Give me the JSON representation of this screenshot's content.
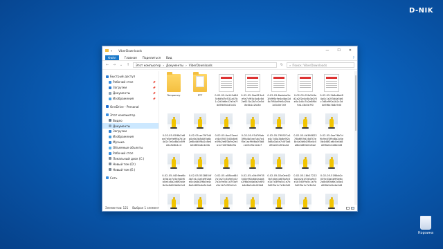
{
  "brand": "D-NIK",
  "desktop": {
    "recycle_label": "Корзина"
  },
  "window": {
    "title": "ViberDownloads",
    "controls": {
      "minimize": "—",
      "maximize": "☐",
      "close": "✕"
    },
    "ribbon": {
      "file": "Файл",
      "tabs": [
        "Главная",
        "Поделиться",
        "Вид"
      ],
      "help": "?"
    },
    "address": {
      "segments": [
        "Этот компьютер",
        "Документы",
        "ViberDownloads"
      ],
      "search_placeholder": "Поиск: ViberDownloads"
    },
    "nav": [
      {
        "label": "Быстрый доступ",
        "icon": "star-icon",
        "color": "#2f7fd3",
        "pin": false,
        "sub": false
      },
      {
        "label": "Рабочий стол",
        "icon": "desktop-icon",
        "color": "#3b8fe0",
        "pin": true,
        "sub": true
      },
      {
        "label": "Загрузки",
        "icon": "download-icon",
        "color": "#2f7fd3",
        "pin": true,
        "sub": true
      },
      {
        "label": "Документы",
        "icon": "documents-icon",
        "color": "#8aa2b8",
        "pin": true,
        "sub": true
      },
      {
        "label": "Изображения",
        "icon": "pictures-icon",
        "color": "#4aa0e0",
        "pin": true,
        "sub": true
      },
      {
        "label": "OneDrive - Personal",
        "icon": "cloud-icon",
        "color": "#1f6fd0",
        "pin": false,
        "sub": false,
        "gap": true
      },
      {
        "label": "Этот компьютер",
        "icon": "computer-icon",
        "color": "#3b8fe0",
        "pin": false,
        "sub": false,
        "gap": true
      },
      {
        "label": "Видео",
        "icon": "video-icon",
        "color": "#6a7b8c",
        "pin": false,
        "sub": true
      },
      {
        "label": "Документы",
        "icon": "documents-icon",
        "color": "#8aa2b8",
        "pin": false,
        "sub": true,
        "selected": true
      },
      {
        "label": "Загрузки",
        "icon": "download-icon",
        "color": "#2f7fd3",
        "pin": false,
        "sub": true
      },
      {
        "label": "Изображения",
        "icon": "pictures-icon",
        "color": "#4aa0e0",
        "pin": false,
        "sub": true
      },
      {
        "label": "Музыка",
        "icon": "music-icon",
        "color": "#2f7fd3",
        "pin": false,
        "sub": true
      },
      {
        "label": "Объемные объекты",
        "icon": "3d-objects-icon",
        "color": "#5ab0e8",
        "pin": false,
        "sub": true
      },
      {
        "label": "Рабочий стол",
        "icon": "desktop-icon",
        "color": "#3b8fe0",
        "pin": false,
        "sub": true
      },
      {
        "label": "Локальный диск (C:)",
        "icon": "drive-icon",
        "color": "#7f8c99",
        "pin": false,
        "sub": true
      },
      {
        "label": "Новый том (D:)",
        "icon": "drive-icon",
        "color": "#7f8c99",
        "pin": false,
        "sub": true
      },
      {
        "label": "Новый том (E:)",
        "icon": "drive-icon",
        "color": "#7f8c99",
        "pin": false,
        "sub": true
      },
      {
        "label": "Сеть",
        "icon": "network-icon",
        "color": "#3b8fe0",
        "pin": false,
        "sub": false,
        "gap": true
      }
    ],
    "files": [
      {
        "name": "Temporary",
        "kind": "folder"
      },
      {
        "name": "PTT",
        "kind": "folder-doc"
      },
      {
        "name": "0-02-05-0a141d865c6dfd7e531a47b1c2d0d6e47a0e7fdd5fb9b1d3c01",
        "kind": "doc"
      },
      {
        "name": "0-02-05-1ba813e4e9a7c9f4c0a4c6d2e61f1a2b7c0e5d8e0b1c2fa3e",
        "kind": "doc"
      },
      {
        "name": "0-02-05-8adebe2e1fd9f6c9e4e4be2d8c7f64a9fe5a2fcb1d3c0e7a9",
        "kind": "doc"
      },
      {
        "name": "0-02-05-05fe5b3ad2a2f2e4c6b3e2f0e0a1d4c7b2e8f6d9a1c3b5e7f0",
        "kind": "doc"
      },
      {
        "name": "0-02-05-2b8a6bd84a0c1e2f3d4a5b6c7d8e9f0a1b2c3d4e5f6a7b8c9d0",
        "kind": "doc"
      },
      {
        "name": "",
        "kind": "empty"
      },
      {
        "name": "0-02-05-05f8b2d6ee7e5e9eff6a7d1e4d2c7e0a8b3c6f9d2a5e8b1c4",
        "kind": "photo"
      },
      {
        "name": "0-02-05-ae79f7d4a0c6e2b8d4f0a6c2e8b4d0f6a2c8e4b0d6f2a8c4e0b",
        "kind": "photo"
      },
      {
        "name": "0-02-05-6ac52eedcf4c09057d3b6e6e59b2e6f3b9e2e4a1c7d0f3b6e9a",
        "kind": "photo"
      },
      {
        "name": "0-02-05-97d7f6ab3f9b4b5ee7ab7e4f5e1ac9fd6a0f3b8c2e5d9a1b4c7",
        "kind": "photo"
      },
      {
        "name": "0-02-05-7ff0927a1e4c7d0a3b6e9f2c5d8a1b4e7c0f3a6d9b2e5c8f1a4d",
        "kind": "photo"
      },
      {
        "name": "0-02-05-4b36082276b6f09d16d7f2e8c4a0b6d2f8e4c0a6b2d8f4e0c6a2",
        "kind": "photo"
      },
      {
        "name": "0-02-05-0ae76b7d9b9e4f3f9d8a2c6e0b4d8f2a6c0e4b8d2f6a0c4e8b2d6",
        "kind": "photo"
      },
      {
        "name": "",
        "kind": "empty"
      },
      {
        "name": "0-02-05-4436ea6b4f3b1e7c5a9d2f6b0e4c8a2d6f0b4e8c2a6d0f4b8e2c6",
        "kind": "photo"
      },
      {
        "name": "0-02-05-5528654f4b7e1c3a5d9f2b6e0c4a8d2f6b0e4c8a2d6f0b4e8c2a6",
        "kind": "photo"
      },
      {
        "name": "0-02-05-a08bcd847a7a27c3b9e5d1f7a3c9e5b1d7f3a9c5e1b7d3f9a5c1",
        "kind": "photo"
      },
      {
        "name": "0-02-05-c0d49978540e9f2b6d0a4e8c2f6b0d4a8e2c6f0b4d8a2e6c0f4b8",
        "kind": "photo"
      },
      {
        "name": "0-02-05-02a0ed427b7d0e1b6f3a9c5e1b7d3f9a5c1e7b3d9f5a1c7e3b9d5",
        "kind": "photo"
      },
      {
        "name": "0-02-05-18b172220a3e2b1f7d3a9c5e1b7d3f9a5c1e7b3d9f5a1c7e3b9d",
        "kind": "photo"
      },
      {
        "name": "0-02-05-51f8bb2c039c03a4b9f0e6c2a8d4f0b6e2c8a4d0f6b2e8c4a0d6",
        "kind": "photo"
      },
      {
        "name": "",
        "kind": "empty"
      },
      {
        "name": "",
        "kind": "photo"
      },
      {
        "name": "",
        "kind": "photo"
      },
      {
        "name": "",
        "kind": "photo"
      },
      {
        "name": "",
        "kind": "photo"
      },
      {
        "name": "",
        "kind": "photo"
      },
      {
        "name": "",
        "kind": "photo"
      },
      {
        "name": "",
        "kind": "photo"
      }
    ],
    "status": {
      "count": "Элементов: 121",
      "selected": "Выбран 1 элемент"
    }
  }
}
